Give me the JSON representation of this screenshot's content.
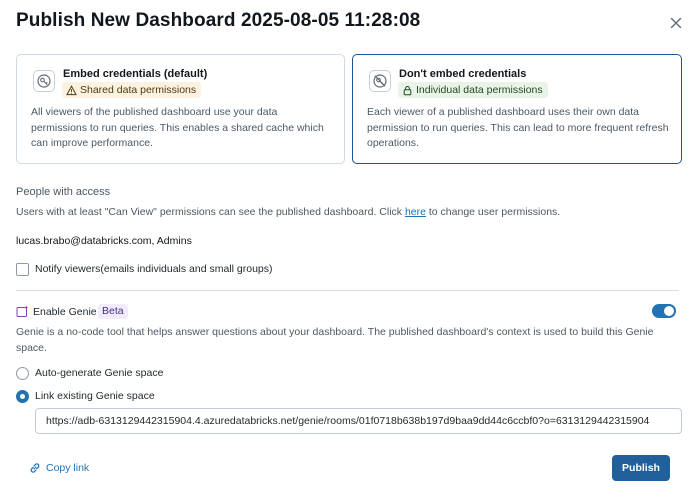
{
  "dialog": {
    "title": "Publish New Dashboard 2025-08-05 11:28:08"
  },
  "credentials": {
    "options": [
      {
        "title": "Embed credentials (default)",
        "badge": "Shared data permissions",
        "badge_icon": "warning-icon",
        "description": "All viewers of the published dashboard use your data permissions to run queries. This enables a shared cache which can improve performance.",
        "selected": false
      },
      {
        "title": "Don't embed credentials",
        "badge": "Individual data permissions",
        "badge_icon": "lock-icon",
        "description": "Each viewer of a published dashboard uses their own data permission to run queries. This can lead to more frequent refresh operations.",
        "selected": true
      }
    ]
  },
  "access": {
    "label": "People with access",
    "help_prefix": "Users with at least \"Can View\" permissions can see the published dashboard. Click ",
    "help_link": "here",
    "help_suffix": " to change user permissions.",
    "owners": "lucas.brabo@databricks.com, Admins"
  },
  "notify": {
    "label_main": "Notify viewers",
    "label_detail": "(emails individuals and small groups)",
    "checked": false
  },
  "genie": {
    "label": "Enable Genie",
    "badge": "Beta",
    "enabled": true,
    "description": "Genie is a no-code tool that helps answer questions about your dashboard. The published dashboard's context is used to build this Genie space.",
    "options": [
      {
        "label": "Auto-generate Genie space",
        "checked": false
      },
      {
        "label": "Link existing Genie space",
        "checked": true
      }
    ],
    "url": "https://adb-6313129442315904.4.azuredatabricks.net/genie/rooms/01f0718b638b197d9baa9dd44c6ccbf0?o=6313129442315904"
  },
  "footer": {
    "copy_link": "Copy link",
    "publish": "Publish"
  },
  "colors": {
    "accent": "#2272b4",
    "primary_button": "#22609c",
    "selected_border": "#1b5591"
  }
}
